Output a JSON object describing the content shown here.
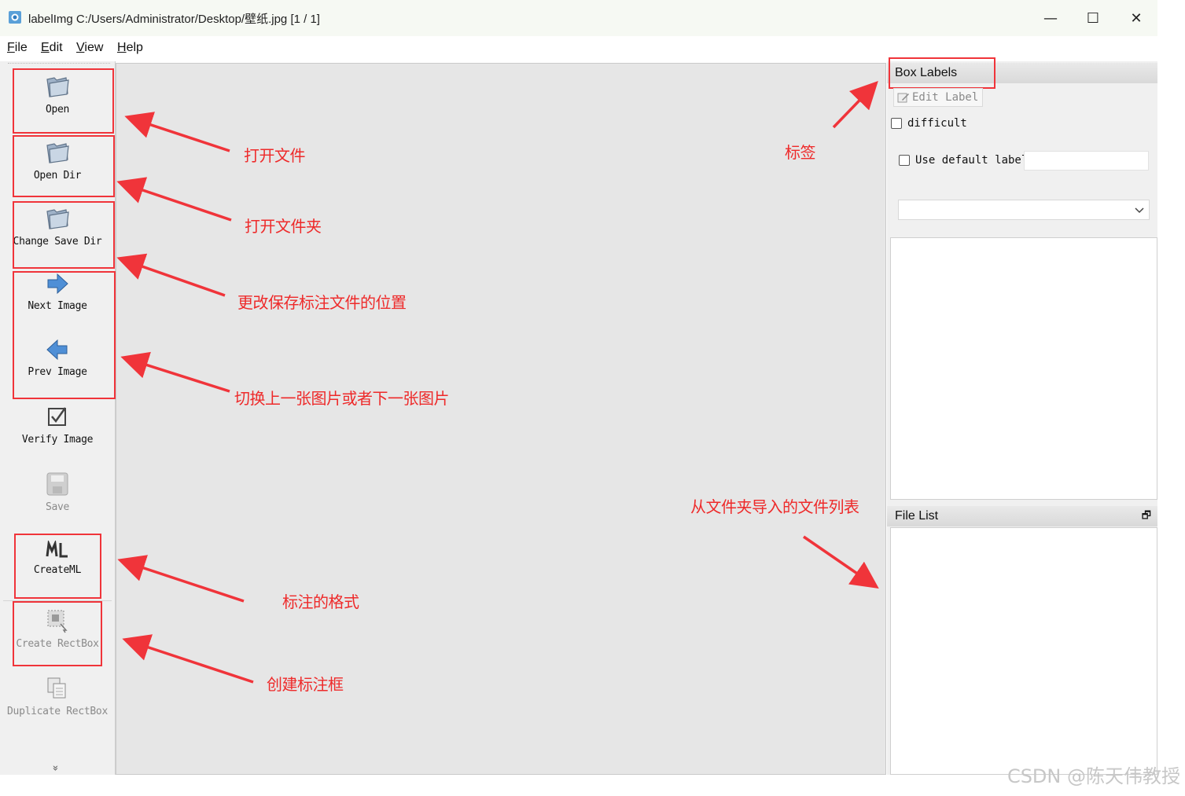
{
  "window": {
    "title": "labelImg C:/Users/Administrator/Desktop/壁纸.jpg [1 / 1]",
    "min_glyph": "—",
    "max_glyph": "☐",
    "close_glyph": "✕"
  },
  "menu": [
    {
      "underline": "F",
      "rest": "ile"
    },
    {
      "underline": "E",
      "rest": "dit"
    },
    {
      "underline": "V",
      "rest": "iew"
    },
    {
      "underline": "H",
      "rest": "elp"
    }
  ],
  "toolbar": {
    "open": "Open",
    "open_dir": "Open Dir",
    "change_save_dir": "Change Save Dir",
    "next_image": "Next Image",
    "prev_image": "Prev Image",
    "verify_image": "Verify Image",
    "save": "Save",
    "create_ml": "CreateML",
    "create_rectbox": "Create RectBox",
    "duplicate_rectbox": "Duplicate RectBox",
    "more_glyph": "»"
  },
  "box_labels": {
    "title": "Box Labels",
    "edit_label": "Edit Label",
    "difficult": "difficult",
    "use_default_label": "Use default label",
    "default_label_value": "",
    "dropdown_value": ""
  },
  "file_list": {
    "title": "File List",
    "float_glyph": "🗗"
  },
  "annotations": {
    "open_file": "打开文件",
    "open_folder": "打开文件夹",
    "change_save": "更改保存标注文件的位置",
    "switch_image": "切换上一张图片或者下一张图片",
    "format": "标注的格式",
    "create_box": "创建标注框",
    "label": "标签",
    "file_list": "从文件夹导入的文件列表"
  },
  "watermark": "CSDN @陈天伟教授",
  "colors": {
    "annotation_red": "#f0343a",
    "canvas": "#e6e6e6",
    "panel": "#f0f0f0"
  }
}
